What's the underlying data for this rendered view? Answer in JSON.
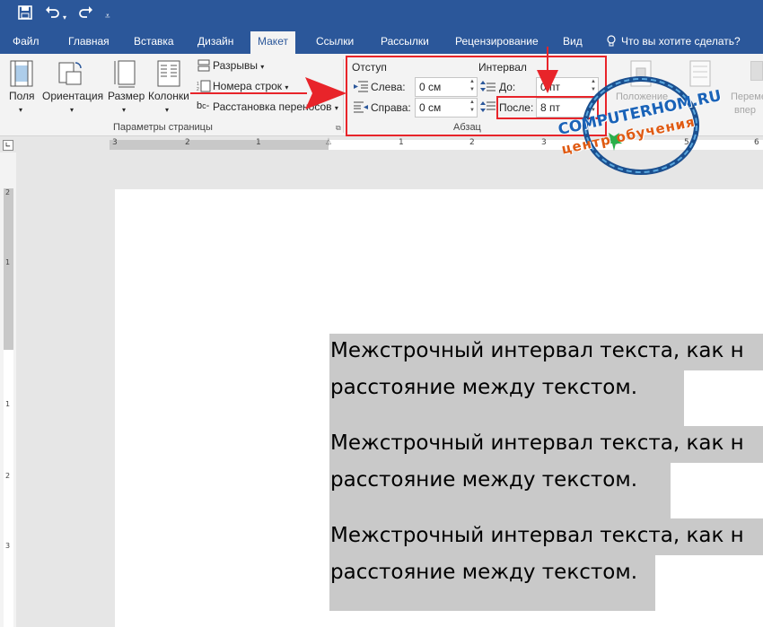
{
  "quick_access": {
    "save_icon": "save-icon",
    "undo_icon": "undo-icon",
    "redo_icon": "redo-icon"
  },
  "tabs": [
    "Файл",
    "Главная",
    "Вставка",
    "Дизайн",
    "Макет",
    "Ссылки",
    "Рассылки",
    "Рецензирование",
    "Вид"
  ],
  "active_tab": "Макет",
  "tell_me": "Что вы хотите сделать?",
  "page_setup": {
    "buttons": [
      "Поля",
      "Ориентация",
      "Размер",
      "Колонки"
    ],
    "breaks": "Разрывы",
    "line_numbers": "Номера строк",
    "hyphenation": "Расстановка переносов",
    "group_label": "Параметры страницы"
  },
  "paragraph": {
    "indent_title": "Отступ",
    "spacing_title": "Интервал",
    "left_label": "Слева:",
    "left_value": "0 см",
    "right_label": "Справа:",
    "right_value": "0 см",
    "before_label": "До:",
    "before_value": "0 пт",
    "after_label": "После:",
    "after_value": "8 пт",
    "group_label": "Абзац"
  },
  "arrange_partial": [
    "Положение",
    "Переме",
    "впер"
  ],
  "watermark": {
    "line1": "COMPUTERHOM.RU",
    "line2": "центр обучения"
  },
  "ruler_numbers": [
    "3",
    "2",
    "1",
    "1",
    "2",
    "3",
    "4",
    "5",
    "6"
  ],
  "vruler_numbers": [
    "2",
    "1",
    "1",
    "2",
    "3"
  ],
  "document": {
    "lines": [
      "Межстрочный интервал текста, как н",
      "расстояние между текстом.",
      "Межстрочный интервал текста, как н",
      "расстояние между текстом.",
      " Межстрочный интервал текста, как н",
      "расстояние между текстом."
    ]
  },
  "colors": {
    "title_bar": "#2b579a",
    "ribbon": "#f3f3f3",
    "highlight": "#c9c9c9",
    "annotation": "#e8242a"
  }
}
